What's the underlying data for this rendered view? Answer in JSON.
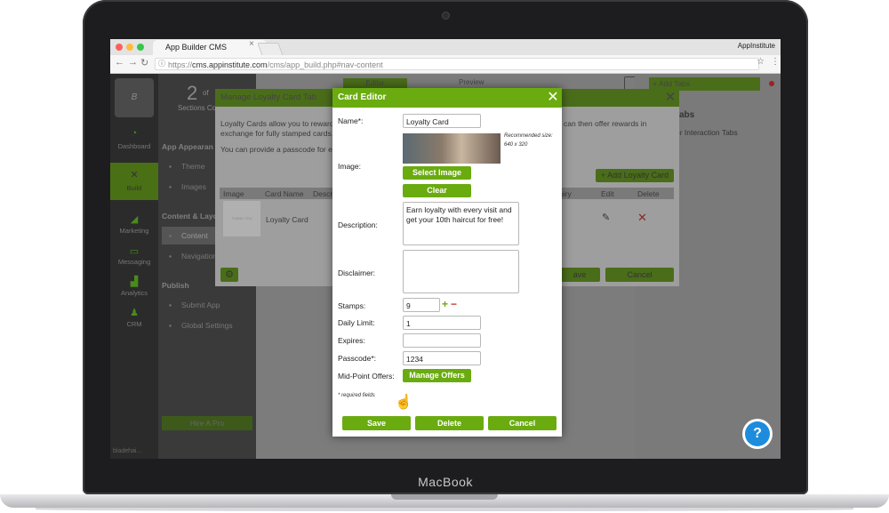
{
  "device": {
    "chin_label": "MacBook"
  },
  "browser": {
    "tab_title": "App Builder CMS",
    "user_label": "AppInstitute",
    "url_scheme": "https://",
    "url_host": "cms.appinstitute.com",
    "url_path": "/cms/app_build.php#nav-content"
  },
  "sidebar": {
    "items": [
      {
        "label": "Dashboard",
        "icon": "speedometer-icon"
      },
      {
        "label": "Build",
        "icon": "tools-icon"
      },
      {
        "label": "Marketing",
        "icon": "megaphone-icon"
      },
      {
        "label": "Messaging",
        "icon": "chat-icon"
      },
      {
        "label": "Analytics",
        "icon": "chart-icon"
      },
      {
        "label": "CRM",
        "icon": "people-icon"
      }
    ],
    "user_short": "bladehai..."
  },
  "sub_sidebar": {
    "count_big": "2",
    "count_of": "of",
    "sections_label": "Sections Co",
    "app_appearance": "App Appearan",
    "theme": "Theme",
    "images": "Images",
    "content_layout": "Content & Layo",
    "content": "Content",
    "navigation": "Navigation",
    "publish": "Publish",
    "submit_app": "Submit App",
    "global_settings": "Global Settings",
    "hire_pro": "Hire A Pro"
  },
  "top_tabs": {
    "editor": "Editor",
    "preview": "Preview",
    "add_tabs": "+ Add Tabs"
  },
  "right_panel": {
    "title": "abs",
    "subtitle": "er Interaction Tabs"
  },
  "manage_dialog": {
    "title": "Manage Loyalty Card Tab",
    "line1_left": "Loyalty Cards allow you to reward y",
    "line1_right": "can then offer rewards in",
    "line2": "exchange for fully stamped cards.",
    "line3": "You can provide a passcode for eac",
    "add_button": "+ Add Loyalty Card",
    "columns": [
      "Image",
      "Card Name",
      "Descr",
      "piry",
      "Edit",
      "Delete"
    ],
    "row_thumb_text": "THANK YOU",
    "row_name": "Loyalty Card",
    "save_button": "ave",
    "cancel_button": "Cancel"
  },
  "card_editor": {
    "title": "Card Editor",
    "labels": {
      "name": "Name*:",
      "image": "Image:",
      "description": "Description:",
      "disclaimer": "Disclaimer:",
      "stamps": "Stamps:",
      "daily_limit": "Daily Limit:",
      "expires": "Expires:",
      "passcode": "Passcode*:",
      "mid_point": "Mid-Point Offers:"
    },
    "values": {
      "name": "Loyalty Card",
      "description": "Earn loyalty with every visit and get your 10th haircut for free!",
      "disclaimer": "",
      "stamps": "9",
      "daily_limit": "1",
      "expires": "",
      "passcode": "1234"
    },
    "recommended_size_label": "Recommended size:",
    "recommended_size_value": "640 x 320",
    "select_image": "Select Image",
    "clear": "Clear",
    "manage_offers": "Manage Offers",
    "required_note": "* required fields",
    "save": "Save",
    "delete": "Delete",
    "cancel": "Cancel"
  },
  "help_icon": "?",
  "colors": {
    "accent": "#6aab10",
    "help": "#1d8cdc",
    "delete_x": "#c0392b"
  }
}
